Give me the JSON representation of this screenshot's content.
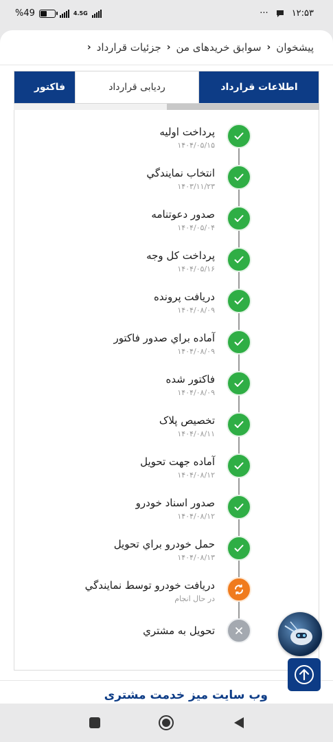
{
  "status_bar": {
    "battery": "49",
    "battery_symbol": "%",
    "network": "4.5G",
    "time": "۱۲:۵۳",
    "more": "···"
  },
  "breadcrumb": {
    "items": [
      "پیشخوان",
      "سوابق خریدهای من",
      "جزئیات قرارداد"
    ]
  },
  "tabs": [
    {
      "label": "اطلاعات قرارداد",
      "state": "selected"
    },
    {
      "label": "ردیابی قرارداد",
      "state": "white"
    },
    {
      "label": "فاکتور",
      "state": "selected"
    }
  ],
  "tab_indicator_progress": 0.5,
  "steps": [
    {
      "title": "پرداخت اولیه",
      "date": "۱۴۰۴/۰۵/۱۵",
      "status": "done"
    },
    {
      "title": "انتخاب نمایندگي",
      "date": "۱۴۰۳/۱۱/۲۳",
      "status": "done"
    },
    {
      "title": "صدور دعوتنامه",
      "date": "۱۴۰۴/۰۵/۰۴",
      "status": "done"
    },
    {
      "title": "پرداخت کل وجه",
      "date": "۱۴۰۴/۰۵/۱۶",
      "status": "done"
    },
    {
      "title": "دریافت پرونده",
      "date": "۱۴۰۴/۰۸/۰۹",
      "status": "done"
    },
    {
      "title": "آماده براي صدور فاکتور",
      "date": "۱۴۰۴/۰۸/۰۹",
      "status": "done"
    },
    {
      "title": "فاکتور شده",
      "date": "۱۴۰۴/۰۸/۰۹",
      "status": "done"
    },
    {
      "title": "تخصیص پلاک",
      "date": "۱۴۰۴/۰۸/۱۱",
      "status": "done"
    },
    {
      "title": "آماده جهت تحویل",
      "date": "۱۴۰۴/۰۸/۱۲",
      "status": "done"
    },
    {
      "title": "صدور اسناد خودرو",
      "date": "۱۴۰۴/۰۸/۱۲",
      "status": "done"
    },
    {
      "title": "حمل خودرو براي تحويل",
      "date": "۱۴۰۴/۰۸/۱۳",
      "status": "done"
    },
    {
      "title": "دریافت خودرو توسط نمایندگي",
      "date": "در حال انجام",
      "status": "in-progress"
    },
    {
      "title": "تحویل به مشتري",
      "date": "",
      "status": "pending"
    }
  ],
  "footer": {
    "link_text": "وب سایت میز خدمت مشتری"
  },
  "colors": {
    "brand_blue": "#0d3c86",
    "done_green": "#2fae45",
    "progress_orange": "#f07b1d",
    "pending_gray": "#a4a9b0"
  },
  "icons": {
    "done": "check-icon",
    "in-progress": "refresh-icon",
    "pending": "close-icon",
    "breadcrumb_separator": "chevron-left-icon",
    "scroll_top": "arrow-up-circle-icon",
    "assistant": "robot-avatar-icon"
  }
}
